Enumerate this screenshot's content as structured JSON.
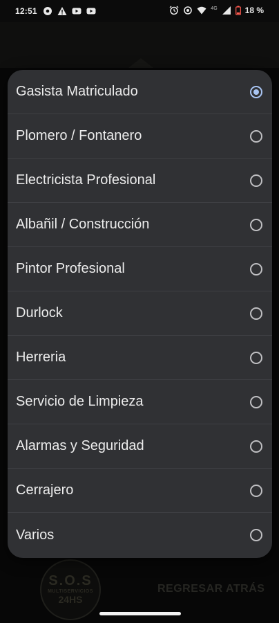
{
  "status_bar": {
    "time": "12:51",
    "left_icons": [
      "settings-icon",
      "warning-icon",
      "youtube-icon",
      "youtube-icon"
    ],
    "right_icons": [
      "alarm-icon",
      "data-saver-icon",
      "wifi-icon",
      "signal-icon",
      "battery-icon"
    ],
    "network": "4G",
    "battery": "18 %",
    "battery_color": "#ff5a4f"
  },
  "background_app": {
    "logo_line1": "S.O.S",
    "logo_line2": "MULTISERVICIOS",
    "logo_line3": "24HS",
    "back_button": "REGRESAR ATRÁS"
  },
  "dialog": {
    "accent": "#a8c4f2",
    "selected_index": 0,
    "options": [
      {
        "label": "Gasista Matriculado",
        "selected": true
      },
      {
        "label": "Plomero / Fontanero",
        "selected": false
      },
      {
        "label": "Electricista Profesional",
        "selected": false
      },
      {
        "label": "Albañil / Construcción",
        "selected": false
      },
      {
        "label": "Pintor Profesional",
        "selected": false
      },
      {
        "label": "Durlock",
        "selected": false
      },
      {
        "label": "Herreria",
        "selected": false
      },
      {
        "label": "Servicio de Limpieza",
        "selected": false
      },
      {
        "label": "Alarmas y Seguridad",
        "selected": false
      },
      {
        "label": "Cerrajero",
        "selected": false
      },
      {
        "label": "Varios",
        "selected": false
      }
    ]
  }
}
